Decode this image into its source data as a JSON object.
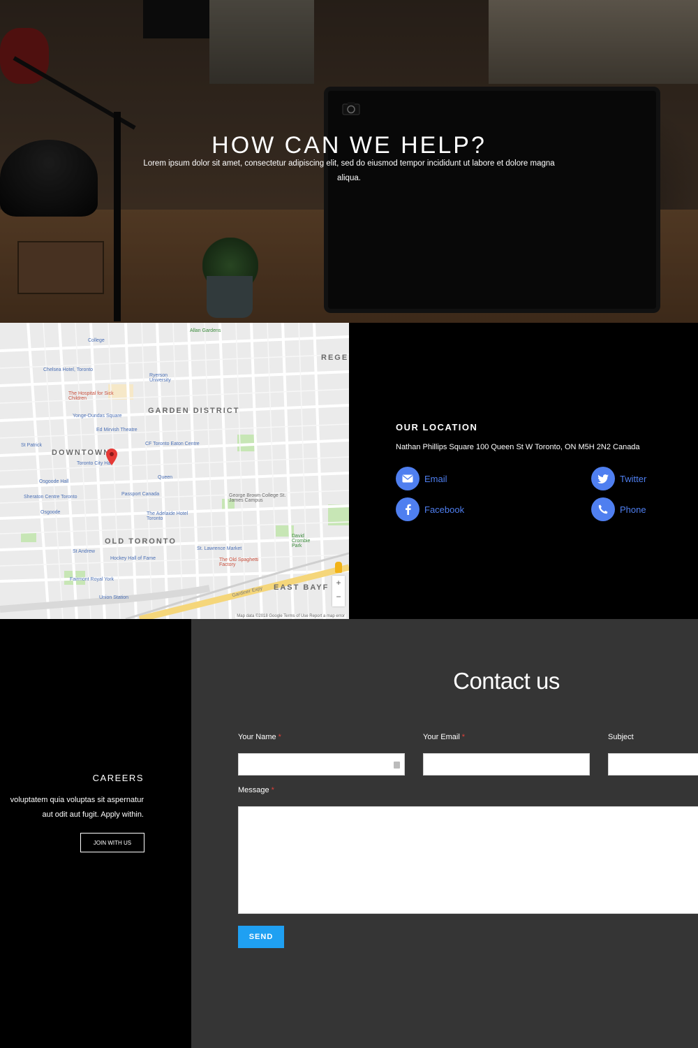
{
  "hero": {
    "title": "HOW CAN WE HELP?",
    "text": "Lorem ipsum dolor sit amet, consectetur adipiscing elit, sed do eiusmod tempor incididunt ut labore et dolore magna aliqua."
  },
  "map": {
    "areas": [
      "GARDEN DISTRICT",
      "DOWNTOWN",
      "OLD TORONTO",
      "EAST BAYF",
      "REGE"
    ],
    "pois": [
      "College",
      "Allan Gardens",
      "Chelsea Hotel, Toronto",
      "The Hospital for Sick Children",
      "Ryerson University",
      "Yonge-Dundas Square",
      "Ed Mirvish Theatre",
      "CF Toronto Eaton Centre",
      "St Patrick",
      "Osgoode Hall",
      "Toronto City Hall",
      "Queen",
      "Sheraton Centre Toronto",
      "Passport Canada",
      "Osgoode",
      "The Adelaide Hotel Toronto",
      "George Brown College St. James Campus",
      "St Andrew",
      "Hockey Hall of Fame",
      "St. Lawrence Market",
      "The Old Spaghetti Factory",
      "Fairmont Royal York",
      "Union Station",
      "David Crombie Park",
      "Gardiner Expy"
    ],
    "attribution": "Map data ©2018 Google   Terms of Use   Report a map error",
    "zoom_in": "+",
    "zoom_out": "−"
  },
  "location": {
    "title": "OUR LOCATION",
    "address": "Nathan Phillips Square 100 Queen St W Toronto, ON M5H 2N2 Canada",
    "links": {
      "email": "Email",
      "twitter": "Twitter",
      "facebook": "Facebook",
      "phone": "Phone"
    },
    "accent": "#4f7ff0"
  },
  "careers": {
    "title": "CAREERS",
    "line1": "voluptatem quia voluptas sit aspernatur",
    "line2": "aut odit aut fugit. Apply within.",
    "button": "JOIN WITH US"
  },
  "contact": {
    "title": "Contact us",
    "name_label": "Your Name",
    "email_label": "Your Email",
    "subject_label": "Subject",
    "message_label": "Message",
    "required_mark": "*",
    "name_value": "",
    "email_value": "",
    "subject_value": "",
    "message_value": "",
    "send": "SEND",
    "send_color": "#1fa0f2",
    "background": "#353535"
  }
}
